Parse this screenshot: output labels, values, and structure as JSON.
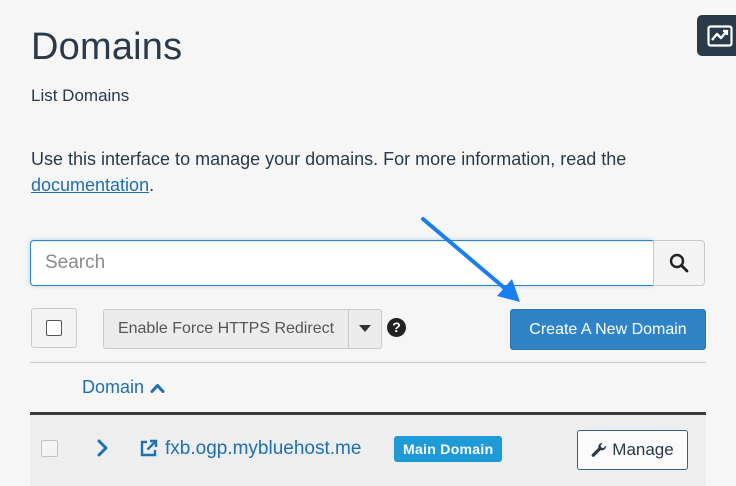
{
  "header": {
    "title": "Domains",
    "subtitle": "List Domains"
  },
  "intro": {
    "text": "Use this interface to manage your domains. For more information, read the ",
    "link_label": "documentation",
    "suffix": "."
  },
  "search": {
    "placeholder": "Search",
    "value": ""
  },
  "toolbar": {
    "force_https_label": "Enable Force HTTPS Redirect",
    "help_label": "?",
    "create_label": "Create A New Domain"
  },
  "table": {
    "columns": [
      {
        "label": "Domain",
        "sort": "ascending"
      }
    ],
    "rows": [
      {
        "domain": "fxb.ogp.mybluehost.me",
        "badge": "Main Domain",
        "action_label": "Manage",
        "checked": false
      }
    ]
  },
  "icons": {
    "stats_tab": "line-chart-icon",
    "search": "search-icon",
    "caret": "caret-down-icon",
    "help": "question-circle-icon",
    "sort": "chevron-up-icon",
    "expand": "chevron-right-icon",
    "external_link": "external-link-icon",
    "manage": "wrench-icon"
  },
  "colors": {
    "primary": "#2f84c8",
    "link": "#1e6fb0",
    "badge": "#1e9bd6",
    "text": "#293a4a",
    "annotation_arrow": "#1a7ef0"
  }
}
